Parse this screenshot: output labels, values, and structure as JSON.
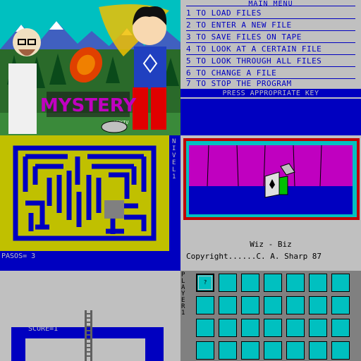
{
  "menu": {
    "header": "MAIN MENU",
    "items": [
      "1 TO LOAD FILES",
      "2 TO ENTER A NEW FILE",
      "3 TO SAVE FILES ON TAPE",
      "4 TO LOOK AT A CERTAIN FILE",
      "5 TO LOOK THROUGH ALL FILES",
      "6 TO CHANGE A FILE",
      "7 TO STOP THE PROGRAM"
    ],
    "prompt": "PRESS APPROPRIATE KEY"
  },
  "title_screen": {
    "logo": "MYSTERY",
    "year": "MMXIV"
  },
  "maze": {
    "pasos": "PASOS= 3",
    "side_label": "NIVEL 1"
  },
  "wiz": {
    "title": "Wiz - Biz",
    "copyright": "Copyright......C. A. Sharp 87"
  },
  "score": {
    "label": "SCORE=1"
  },
  "grid": {
    "side_label": "PLAYER 1",
    "selected_mark": "?"
  },
  "colors": {
    "blue": "#0000c0",
    "yellow": "#c0c000",
    "cyan": "#00c0c0",
    "magenta": "#c000c0",
    "green": "#00c000",
    "red": "#c00000",
    "gray": "#c0c0c0"
  }
}
